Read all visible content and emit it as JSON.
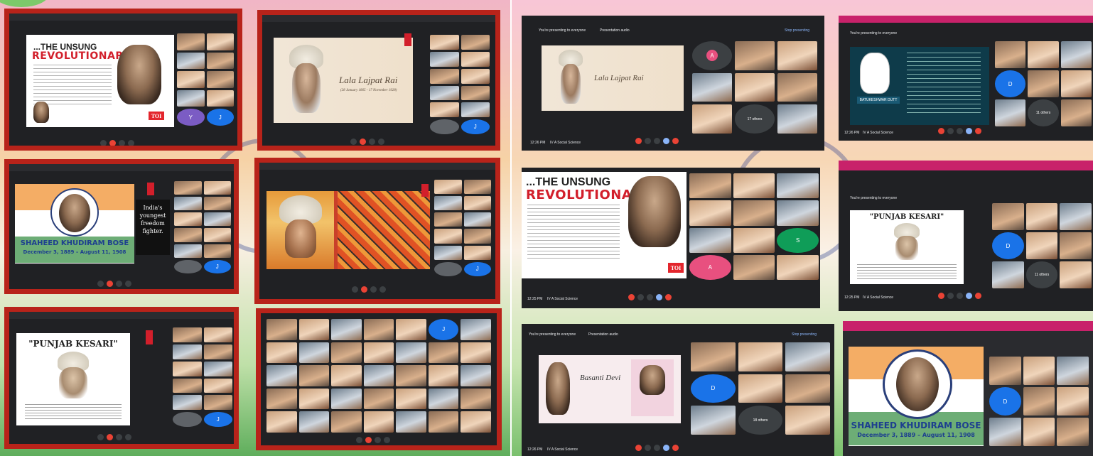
{
  "slides": {
    "unsung": {
      "line1": "...THE UNSUNG",
      "line2": "REVOLUTIONARY",
      "toi": "TOI"
    },
    "lala": {
      "name": "Lala Lajpat Rai",
      "dates": "(28 January 1865 - 17 November 1928)"
    },
    "khudiram": {
      "name": "SHAHEED KHUDIRAM BOSE",
      "dates": "December 3, 1889 – August 11, 1908",
      "caption_l1": "India's",
      "caption_l2": "youngest",
      "caption_l3": "freedom",
      "caption_l4": "fighter."
    },
    "kesari": {
      "title": "\"PUNJAB KESARI\""
    },
    "dutt": {
      "name": "BATUKESHWAR DUTT"
    },
    "basanti": {
      "name": "Basanti Devi"
    }
  },
  "meet": {
    "presenting": "You're presenting to everyone",
    "presentation_audio": "Presentation audio",
    "stop_presenting": "Stop presenting",
    "time1": "12:26 PM",
    "time2": "12:26 PM",
    "time3": "12:25 PM",
    "time4": "12:25 PM",
    "time5": "12:26 PM",
    "meeting_name": "IV A Social Science",
    "tile_D": "D",
    "tile_A": "A",
    "tile_S": "S",
    "tile_Y": "Y",
    "others_17": "17 others",
    "others_11": "11 others",
    "others_18": "18 others"
  },
  "colors": {
    "frame_red": "#b8231a",
    "meet_bg": "#202124",
    "end_call": "#ea4335",
    "accent_blue": "#8ab4f8"
  }
}
